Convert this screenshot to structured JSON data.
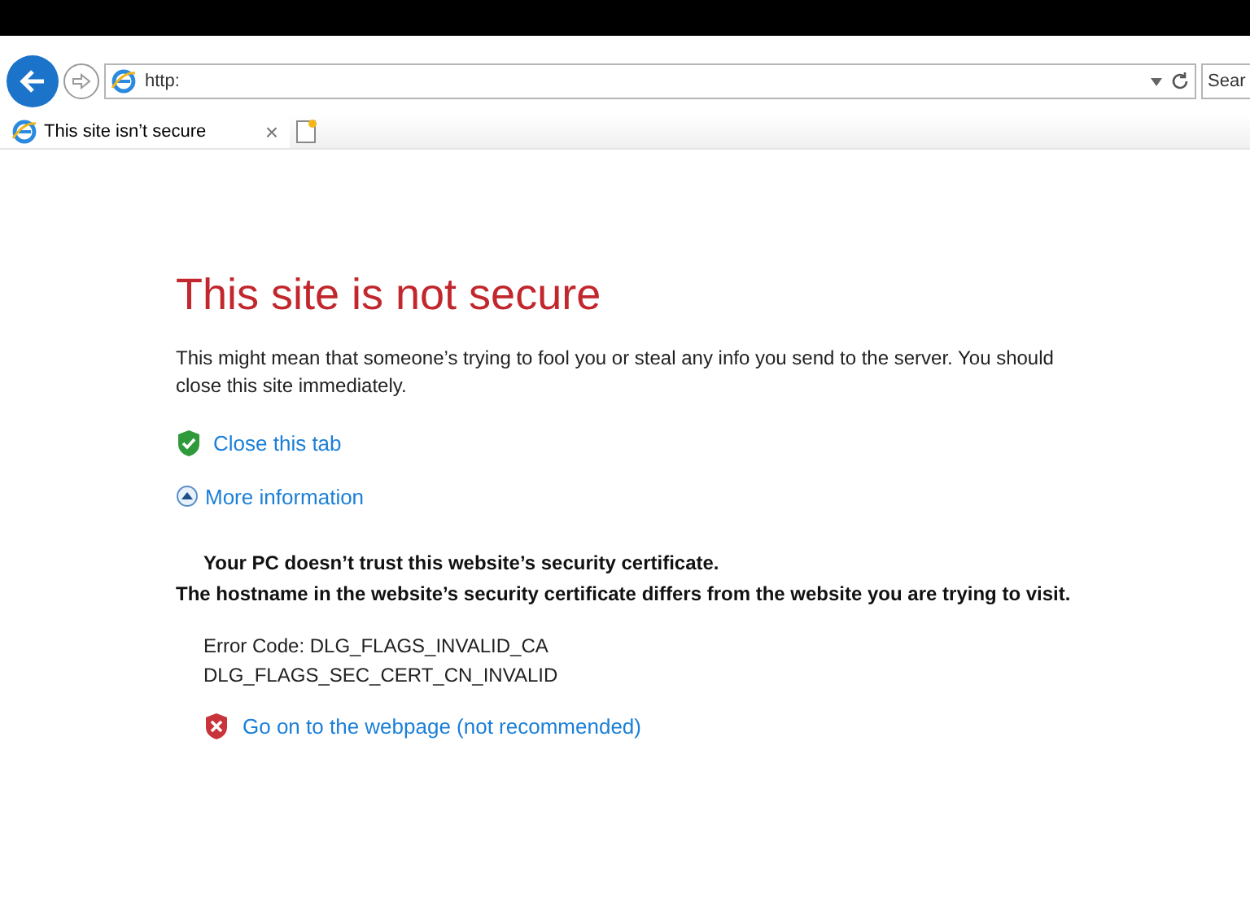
{
  "address_bar": {
    "value": "http:"
  },
  "search": {
    "placeholder": "Sear"
  },
  "tab": {
    "title": "This site isn’t secure",
    "close": "×"
  },
  "page": {
    "title": "This site is not secure",
    "message": "This might mean that someone’s trying to fool you or steal any info you send to the server. You should close this site immediately.",
    "close_link": "Close this tab",
    "more_info": {
      "label": "More information",
      "expanded": true
    },
    "details": [
      "Your PC doesn’t trust this website’s security certificate.",
      "The hostname in the website’s security certificate differs from the website you are trying to visit."
    ],
    "error_codes": [
      "Error Code: DLG_FLAGS_INVALID_CA",
      "DLG_FLAGS_SEC_CERT_CN_INVALID"
    ],
    "continue_link": "Go on to the webpage (not recommended)"
  }
}
